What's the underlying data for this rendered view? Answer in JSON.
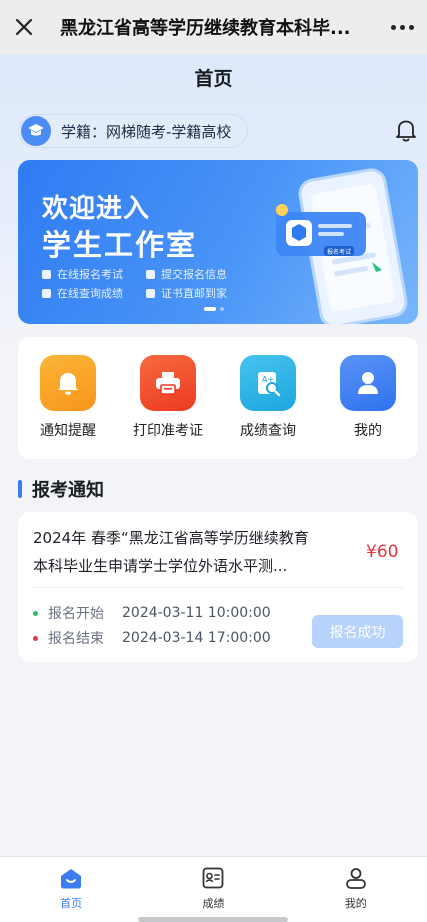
{
  "topbar": {
    "title": "黑龙江省高等学历继续教育本科毕..."
  },
  "page": {
    "title": "首页"
  },
  "xueji": {
    "label": "学籍：网梯随考-学籍高校"
  },
  "banner": {
    "line1": "欢迎进入",
    "line2": "学生工作室",
    "features": [
      "在线报名考试",
      "提交报名信息",
      "在线查询成绩",
      "证书直邮到家"
    ],
    "tag": "报名考试"
  },
  "menu": {
    "items": [
      {
        "label": "通知提醒",
        "icon": "bell-icon",
        "color": "#f7a21b"
      },
      {
        "label": "打印准考证",
        "icon": "printer-icon",
        "color": "#f04a2a"
      },
      {
        "label": "成绩查询",
        "icon": "score-search-icon",
        "color": "#2bb2e6"
      },
      {
        "label": "我的",
        "icon": "user-icon",
        "color": "#3a7df1"
      }
    ]
  },
  "section": {
    "title": "报考通知"
  },
  "notice": {
    "title_line1": "2024年 春季“黑龙江省高等学历继续教育",
    "title_line2": "本科毕业生申请学士学位外语水平测...",
    "price": "¥60",
    "start_label": "报名开始",
    "start_time": "2024-03-11 10:00:00",
    "end_label": "报名结束",
    "end_time": "2024-03-14 17:00:00",
    "status": "报名成功"
  },
  "tabbar": {
    "items": [
      {
        "label": "首页",
        "active": true
      },
      {
        "label": "成绩",
        "active": false
      },
      {
        "label": "我的",
        "active": false
      }
    ]
  },
  "colors": {
    "accent": "#3b7cf0",
    "price": "#e0393c",
    "page_bg": "#f3f4f8"
  }
}
